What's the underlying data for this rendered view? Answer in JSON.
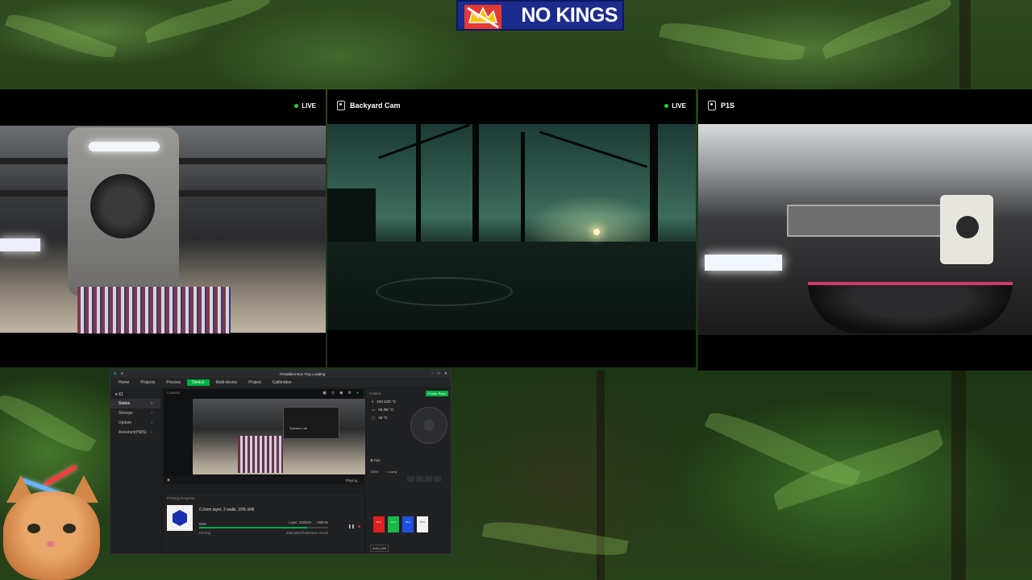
{
  "banner": {
    "text": "NO KINGS"
  },
  "cameras": [
    {
      "name": "",
      "live": "LIVE"
    },
    {
      "name": "Backyard Cam",
      "live": "LIVE"
    },
    {
      "name": "P1S",
      "live": ""
    }
  ],
  "app": {
    "window_title": "Printables Box Tray Loading",
    "device": "X1",
    "tabs": [
      "Home",
      "Projects",
      "Preview",
      "Device",
      "Multi-device",
      "Project",
      "Calibration"
    ],
    "active_tab": "Device",
    "sidebar": [
      "Status",
      "Storage",
      "Update",
      "Assistant(HMS)"
    ],
    "camera_label": "Camera",
    "camera_box_label": "Science Lab",
    "playback_status": "Playing...",
    "progress_header": "Printing Progress",
    "print_info": "0.2mm layer, 2 walls, 10% infill",
    "percent": "84%",
    "progress_fraction": 0.84,
    "layer": "Layer: 339/345 ... -260min",
    "status": "Printing",
    "finish_time": "Estimated finish time: 04-23",
    "control_header": "Control",
    "printer_parts": "Printer Parts",
    "nozzle_temp": "220 /220 °C",
    "bed_temp": "55 /55 °C",
    "chamber_temp": "36 °C",
    "fan_label": "Fan",
    "speed_label": "100%",
    "lamp_label": "Lamp",
    "auto_refill": "Auto-refill",
    "spools": [
      {
        "label": "PLA",
        "color": "#e02020"
      },
      {
        "label": "PLA",
        "color": "#18b84a"
      },
      {
        "label": "PLA",
        "color": "#2050e0"
      },
      {
        "label": "PLA",
        "color": "#f2f2f2"
      }
    ]
  }
}
